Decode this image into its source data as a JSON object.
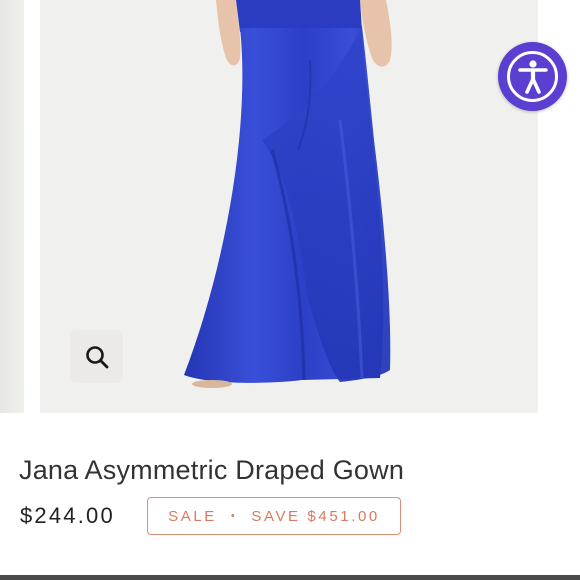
{
  "product": {
    "title": "Jana Asymmetric Draped Gown",
    "price": "$244.00",
    "sale_label": "SALE",
    "separator": "•",
    "savings_label": "SAVE $451.00"
  },
  "icons": {
    "zoom": "magnifier-icon",
    "accessibility": "accessibility-person-icon"
  },
  "colors": {
    "gown": "#2f3fc4",
    "accessibility_button": "#5b3fd1",
    "sale_badge": "#d97a5e",
    "text": "#333333"
  }
}
